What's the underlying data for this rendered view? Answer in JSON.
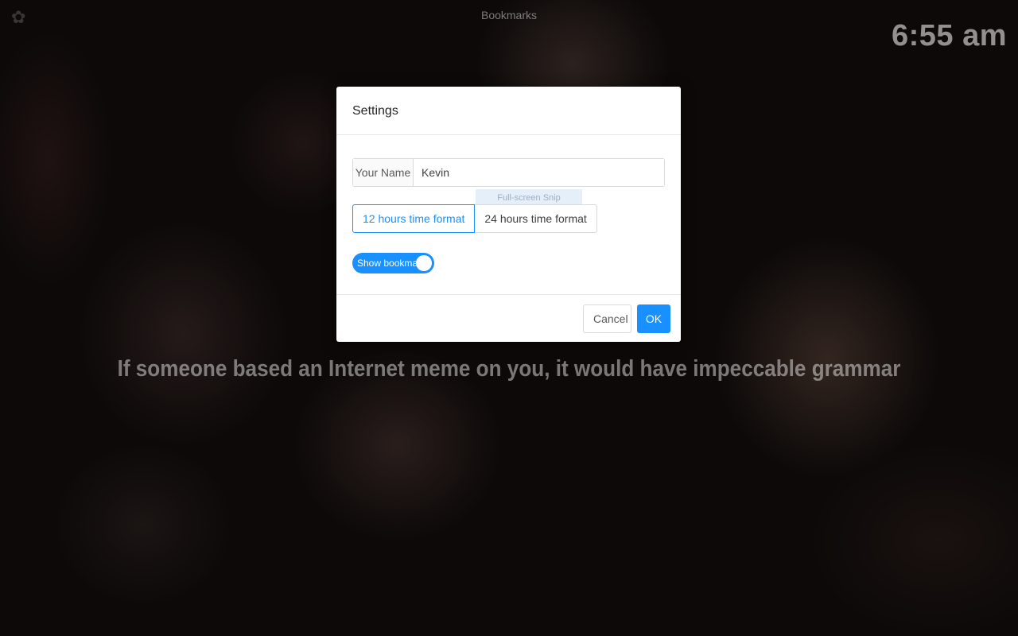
{
  "app": {
    "top_title": "Bookmarks",
    "clock": "6:55 am",
    "quote": "If someone based an Internet meme on you, it would have impeccable grammar"
  },
  "icons": {
    "settings": "gear-icon"
  },
  "settings_modal": {
    "title": "Settings",
    "name_label": "Your Name",
    "name_value": "Kevin",
    "tooltip_ghost": "Full-screen Snip",
    "time_format": {
      "options": [
        "12 hours time format",
        "24 hours time format"
      ],
      "selected": "12 hours time format"
    },
    "bookmarks_toggle": {
      "label": "Show bookmarks",
      "on": true
    },
    "cancel_label": "Cancel",
    "ok_label": "OK"
  },
  "colors": {
    "accent": "#1890ff",
    "modal_bg": "#ffffff",
    "border": "#d9d9d9"
  }
}
